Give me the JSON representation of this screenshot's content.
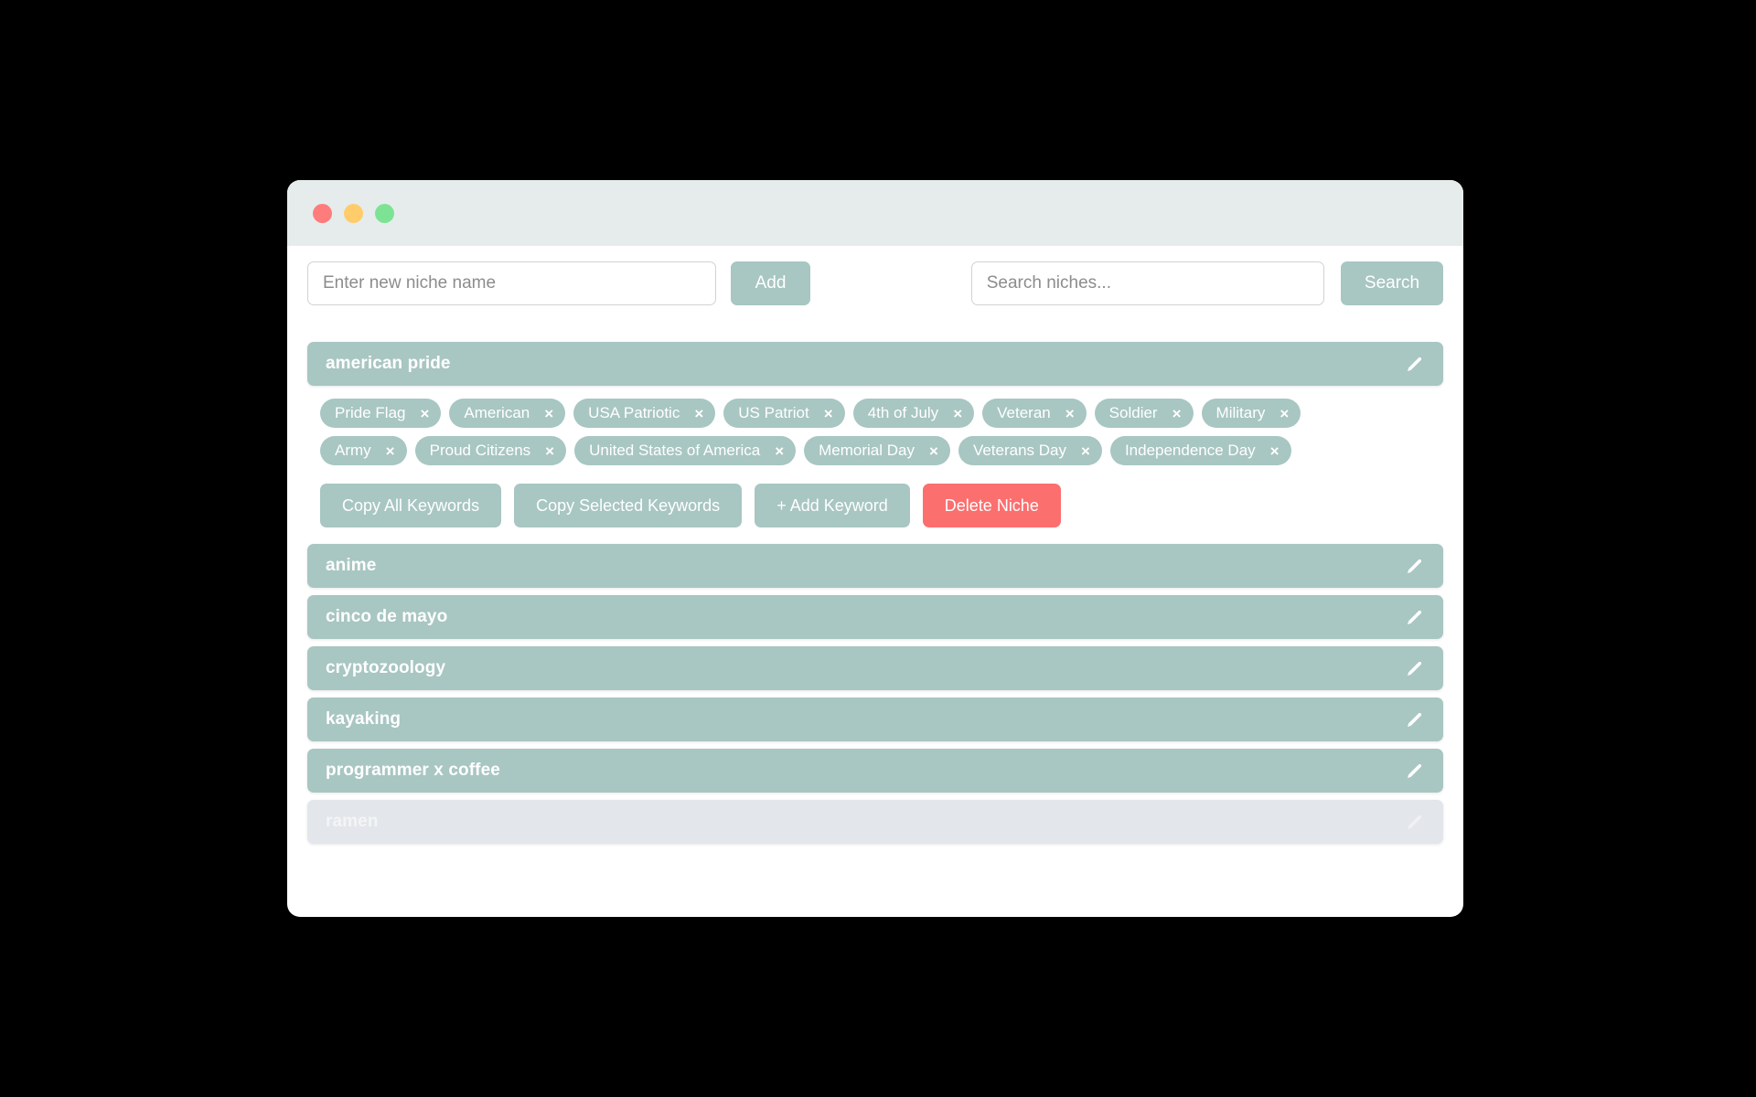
{
  "window": {
    "traffic_lights": [
      {
        "name": "close",
        "color": "#ff7c7c"
      },
      {
        "name": "minimize",
        "color": "#ffcc6b"
      },
      {
        "name": "maximize",
        "color": "#7ce395"
      }
    ],
    "chrome_color": "#e6ecec",
    "accent_color": "#a8c6c2",
    "danger_color": "#fc6f6f"
  },
  "toolbar": {
    "new_niche_placeholder": "Enter new niche name",
    "new_niche_value": "",
    "add_label": "Add",
    "search_placeholder": "Search niches...",
    "search_value": "",
    "search_label": "Search"
  },
  "niches": [
    {
      "name": "american pride",
      "expanded": true,
      "faded": false,
      "edit_icon": "pencil-icon",
      "keyword_rows": [
        [
          "Pride Flag",
          "American",
          "USA Patriotic",
          "US Patriot",
          "4th of July",
          "Veteran",
          "Soldier",
          "Military"
        ],
        [
          "Army",
          "Proud Citizens",
          "United States of America",
          "Memorial Day",
          "Veterans Day",
          "Independence Day"
        ]
      ],
      "remove_glyph": "×",
      "actions": [
        {
          "label": "Copy All Keywords",
          "style": "default"
        },
        {
          "label": "Copy Selected Keywords",
          "style": "default"
        },
        {
          "label": "+ Add Keyword",
          "style": "default"
        },
        {
          "label": "Delete Niche",
          "style": "danger"
        }
      ]
    },
    {
      "name": "anime",
      "expanded": false,
      "faded": false,
      "edit_icon": "pencil-icon"
    },
    {
      "name": "cinco de mayo",
      "expanded": false,
      "faded": false,
      "edit_icon": "pencil-icon"
    },
    {
      "name": "cryptozoology",
      "expanded": false,
      "faded": false,
      "edit_icon": "pencil-icon"
    },
    {
      "name": "kayaking",
      "expanded": false,
      "faded": false,
      "edit_icon": "pencil-icon"
    },
    {
      "name": "programmer x coffee",
      "expanded": false,
      "faded": false,
      "edit_icon": "pencil-icon"
    },
    {
      "name": "ramen",
      "expanded": false,
      "faded": true,
      "edit_icon": "pencil-icon"
    }
  ]
}
